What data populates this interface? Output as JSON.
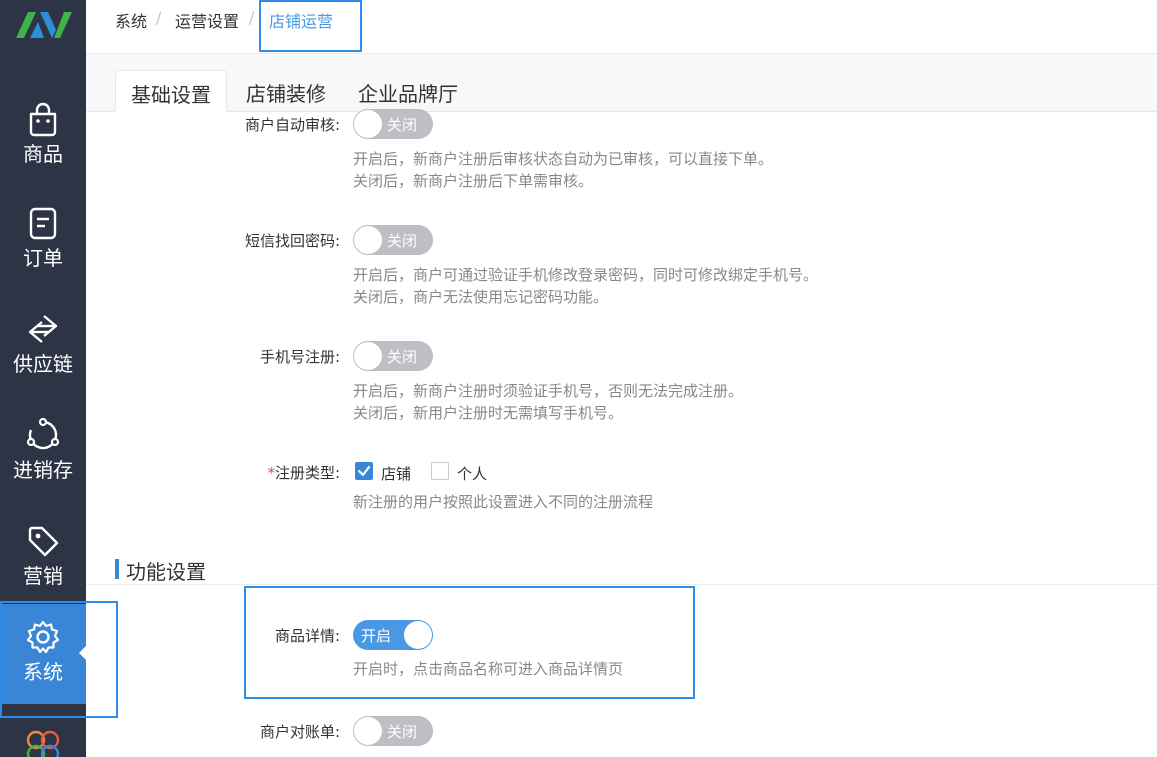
{
  "sidebar": {
    "logo_icon": "logo-icon",
    "items": [
      {
        "label": "商品",
        "icon": "shopping-bag-icon"
      },
      {
        "label": "订单",
        "icon": "order-icon"
      },
      {
        "label": "供应链",
        "icon": "supply-chain-icon"
      },
      {
        "label": "进销存",
        "icon": "inventory-icon"
      },
      {
        "label": "营销",
        "icon": "tag-icon"
      },
      {
        "label": "系统",
        "icon": "gear-icon",
        "active": true
      }
    ]
  },
  "breadcrumb": {
    "items": [
      "系统",
      "运营设置",
      "店铺运营"
    ],
    "separator": "/"
  },
  "tabs": [
    {
      "label": "基础设置",
      "active": true
    },
    {
      "label": "店铺装修",
      "active": false
    },
    {
      "label": "企业品牌厅",
      "active": false
    }
  ],
  "settings": {
    "auto_audit": {
      "label": "商户自动审核:",
      "switch_text": "关闭",
      "desc1": "开启后，新商户注册后审核状态自动为已审核，可以直接下单。",
      "desc2": "关闭后，新商户注册后下单需审核。"
    },
    "sms_password": {
      "label": "短信找回密码:",
      "switch_text": "关闭",
      "desc1": "开启后，商户可通过验证手机修改登录密码，同时可修改绑定手机号。",
      "desc2": "关闭后，商户无法使用忘记密码功能。"
    },
    "phone_register": {
      "label": "手机号注册:",
      "switch_text": "关闭",
      "desc1": "开启后，新商户注册时须验证手机号，否则无法完成注册。",
      "desc2": "关闭后，新用户注册时无需填写手机号。"
    },
    "register_type": {
      "required_mark": "*",
      "label": "注册类型:",
      "options": [
        {
          "label": "店铺",
          "checked": true
        },
        {
          "label": "个人",
          "checked": false
        }
      ],
      "desc": "新注册的用户按照此设置进入不同的注册流程"
    }
  },
  "function_section": {
    "title": "功能设置",
    "product_detail": {
      "label": "商品详情:",
      "switch_text": "开启",
      "desc": "开启时，点击商品名称可进入商品详情页"
    },
    "merchant_statement": {
      "label": "商户对账单:",
      "switch_text": "关闭"
    }
  },
  "colors": {
    "sidebar_bg": "#2c3445",
    "accent": "#3a86d6",
    "switch_off": "#bdbfc4",
    "highlight": "#2f8be8"
  }
}
